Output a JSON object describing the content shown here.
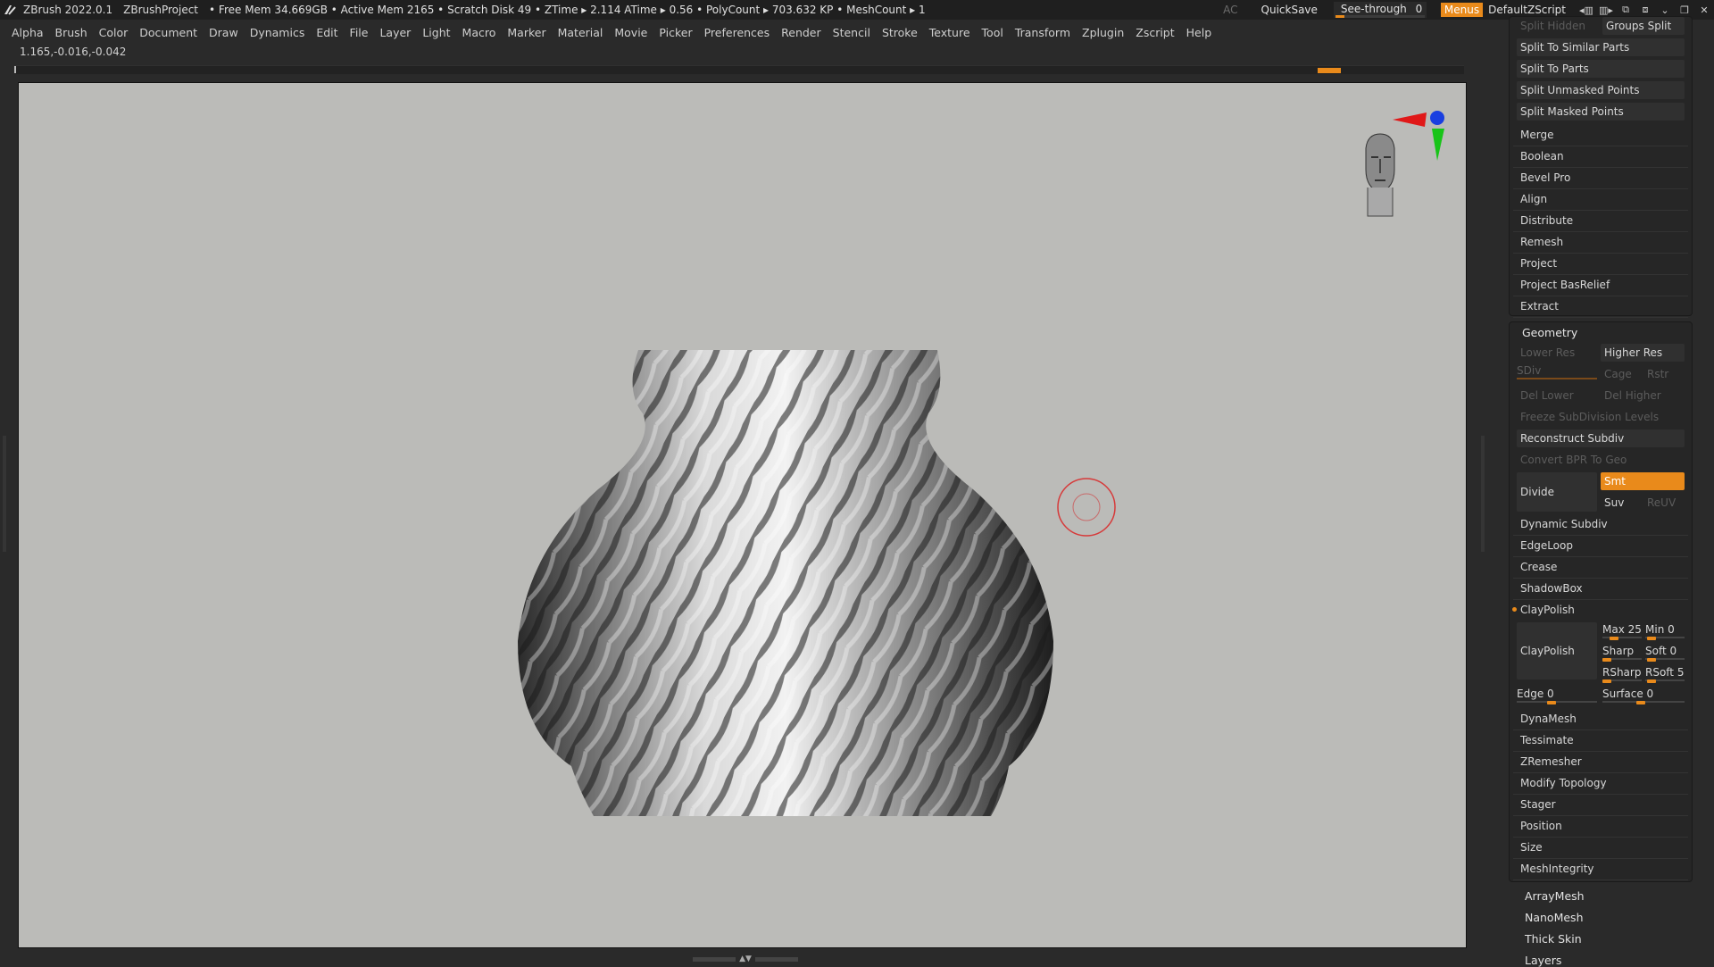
{
  "titlebar": {
    "app": "ZBrush 2022.0.1",
    "project": "ZBrushProject",
    "info": "• Free Mem 34.669GB • Active Mem 2165 • Scratch Disk 49 • ZTime ▸ 2.114 ATime ▸ 0.56 • PolyCount ▸ 703.632 KP • MeshCount ▸ 1",
    "ac": "AC",
    "quicksave": "QuickSave",
    "seethrough": "See-through",
    "seethrough_value": "0",
    "menus": "Menus",
    "script": "DefaultZScript"
  },
  "menubar": [
    "Alpha",
    "Brush",
    "Color",
    "Document",
    "Draw",
    "Dynamics",
    "Edit",
    "File",
    "Layer",
    "Light",
    "Macro",
    "Marker",
    "Material",
    "Movie",
    "Picker",
    "Preferences",
    "Render",
    "Stencil",
    "Stroke",
    "Texture",
    "Tool",
    "Transform",
    "Zplugin",
    "Zscript",
    "Help"
  ],
  "coords": "1.165,-0.016,-0.042",
  "subtool": {
    "split_hidden": "Split Hidden",
    "groups_split": "Groups Split",
    "buttons": [
      "Split To Similar Parts",
      "Split To Parts",
      "Split Unmasked Points",
      "Split Masked Points"
    ],
    "items": [
      "Merge",
      "Boolean",
      "Bevel Pro",
      "Align",
      "Distribute",
      "Remesh",
      "Project",
      "Project BasRelief",
      "Extract"
    ]
  },
  "geometry": {
    "header": "Geometry",
    "lower_res": "Lower Res",
    "higher_res": "Higher Res",
    "sdiv": "SDiv",
    "cage": "Cage",
    "rstr": "Rstr",
    "del_lower": "Del Lower",
    "del_higher": "Del Higher",
    "freeze": "Freeze SubDivision Levels",
    "reconstruct": "Reconstruct Subdiv",
    "convert_bpr": "Convert BPR To Geo",
    "divide": "Divide",
    "smt": "Smt",
    "suv": "Suv",
    "reuv": "ReUV",
    "dynamic_subdiv": "Dynamic Subdiv",
    "edgeloop": "EdgeLoop",
    "crease": "Crease",
    "shadowbox": "ShadowBox",
    "claypolish_header": "ClayPolish",
    "claypolish_btn": "ClayPolish",
    "max": "Max 25",
    "min": "Min 0",
    "sharp": "Sharp",
    "soft": "Soft 0",
    "rsharp": "RSharp",
    "rsoft": "RSoft 5",
    "edge": "Edge 0",
    "surface": "Surface 0",
    "after": [
      "DynaMesh",
      "Tessimate",
      "ZRemesher",
      "Modify Topology",
      "Stager",
      "Position",
      "Size",
      "MeshIntegrity"
    ]
  },
  "bottom_items": [
    "ArrayMesh",
    "NanoMesh",
    "Thick Skin",
    "Layers"
  ],
  "colors": {
    "accent": "#e98a1b",
    "canvas": "#bbbbb8",
    "panel": "#262626"
  }
}
